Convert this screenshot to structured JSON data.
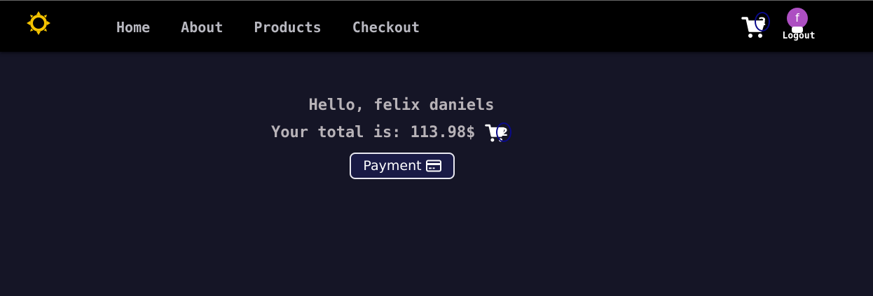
{
  "nav": {
    "theme_icon": "sun-icon",
    "links": [
      "Home",
      "About",
      "Products",
      "Checkout"
    ],
    "cart_icon": "cart-icon",
    "cart_count": "2",
    "user_initial": "f",
    "logout_label": "Logout"
  },
  "main": {
    "greeting": "Hello, felix daniels",
    "total_text": "Your total is: 113.98$",
    "cart_count": "2",
    "payment_label": "Payment",
    "payment_icon": "credit-card-icon"
  },
  "colors": {
    "nav_bg": "#000000",
    "page_bg": "#151526",
    "sun": "#f5c400",
    "avatar": "#ad4fc2",
    "badge_ring": "#0a0a8a",
    "button_bg": "#191a45"
  }
}
